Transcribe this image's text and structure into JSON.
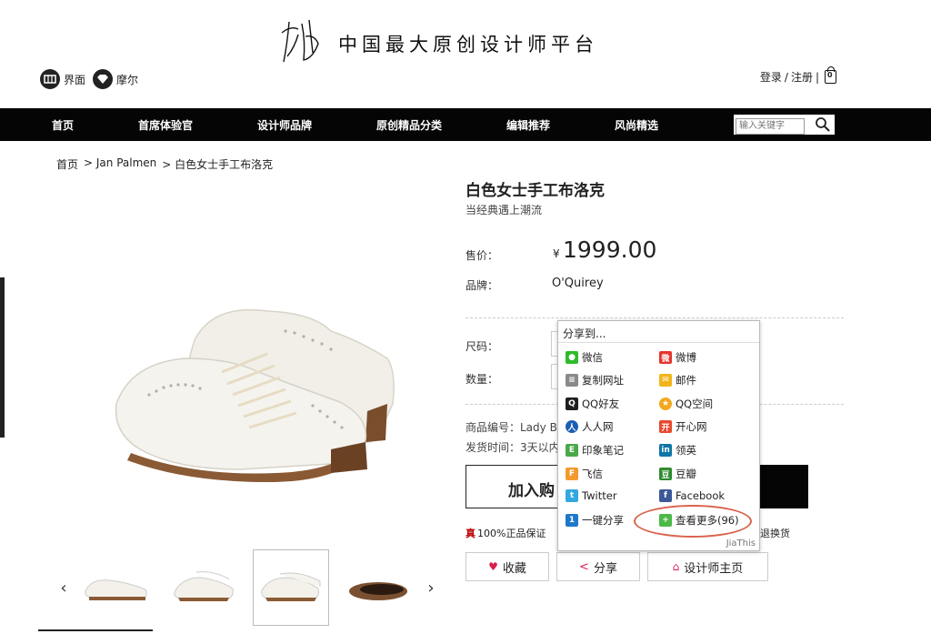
{
  "header": {
    "slogan": "中国最大原创设计师平台",
    "partners": [
      {
        "icon": "jiemian-logo-icon",
        "label": "界面"
      },
      {
        "icon": "moer-logo-icon",
        "label": "摩尔"
      }
    ],
    "login": "登录",
    "separator": "/",
    "register": "注册",
    "bar": "|",
    "cart_count": "0"
  },
  "nav": {
    "items": [
      "首页",
      "首席体验官",
      "设计师品牌",
      "原创精品分类",
      "编辑推荐",
      "风尚精选"
    ],
    "search_placeholder": "输入关键字"
  },
  "breadcrumb": [
    "首页",
    "> Jan Palmen",
    "> 白色女士手工布洛克"
  ],
  "product": {
    "title": "白色女士手工布洛克",
    "subtitle": "当经典遇上潮流",
    "price_label": "售价：",
    "currency": "¥",
    "price": "1999.00",
    "brand_label": "品牌：",
    "brand": "O'Quirey",
    "size_label": "尺码：",
    "qty_label": "数量：",
    "sku_line": "商品编号：Lady B",
    "ship_line": "发货时间：3天以内",
    "buy_label": "加入购",
    "guarantee_mark": "真",
    "guarantee": "100%正品保证",
    "exchange": "退换货"
  },
  "actions": [
    {
      "icon": "heart-icon",
      "label": "收藏"
    },
    {
      "icon": "share-icon",
      "label": "分享"
    },
    {
      "icon": "designer-home-icon",
      "label": "设计师主页"
    }
  ],
  "share": {
    "title": "分享到...",
    "left": [
      {
        "label": "微信",
        "icon": "wechat-icon",
        "color": "#2dbb29"
      },
      {
        "label": "复制网址",
        "icon": "copy-url-icon",
        "color": "#8a8a8a"
      },
      {
        "label": "QQ好友",
        "icon": "qq-icon",
        "color": "#1f1f1f"
      },
      {
        "label": "人人网",
        "icon": "renren-icon",
        "color": "#1b5fb4"
      },
      {
        "label": "印象笔记",
        "icon": "evernote-icon",
        "color": "#4aa84a"
      },
      {
        "label": "飞信",
        "icon": "fetion-icon",
        "color": "#f29a2e"
      },
      {
        "label": "Twitter",
        "icon": "twitter-icon",
        "color": "#33a8e0"
      },
      {
        "label": "一键分享",
        "icon": "one-click-share-icon",
        "color": "#1e78c8"
      }
    ],
    "right": [
      {
        "label": "微博",
        "icon": "weibo-icon",
        "color": "#e6342b"
      },
      {
        "label": "邮件",
        "icon": "mail-icon",
        "color": "#f2b51a"
      },
      {
        "label": "QQ空间",
        "icon": "qzone-icon",
        "color": "#f2a81e"
      },
      {
        "label": "开心网",
        "icon": "kaixin-icon",
        "color": "#e64a2e"
      },
      {
        "label": "领英",
        "icon": "linkedin-icon",
        "color": "#0e76a8"
      },
      {
        "label": "豆瓣",
        "icon": "douban-icon",
        "color": "#2e8b2e"
      },
      {
        "label": "Facebook",
        "icon": "facebook-icon",
        "color": "#3b5998"
      },
      {
        "label": "查看更多(96)",
        "icon": "more-icon",
        "color": "#4cb848"
      }
    ],
    "footer": "JiaThis",
    "highlight_color": "#d9634d"
  }
}
